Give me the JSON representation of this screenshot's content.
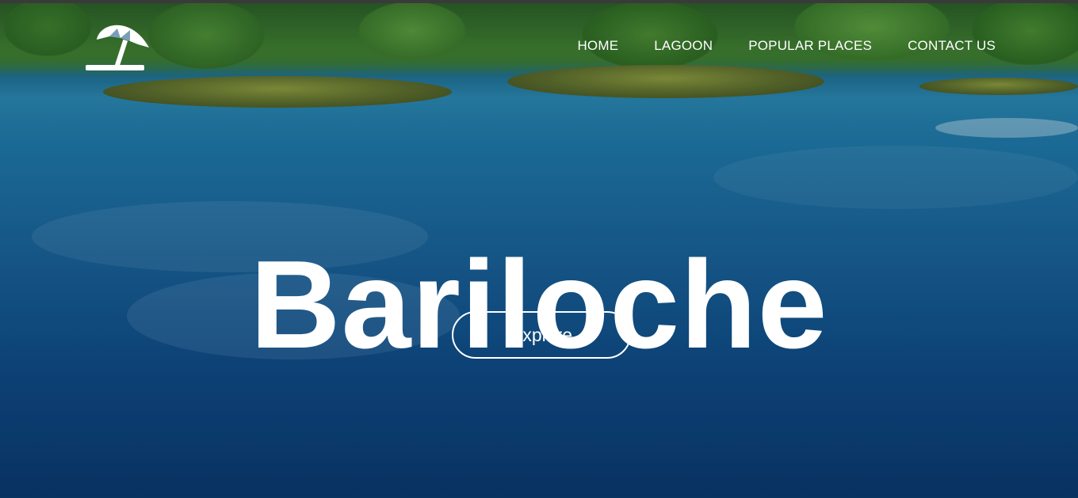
{
  "brand": {
    "logo_icon": "beach-umbrella-icon"
  },
  "nav": {
    "items": [
      {
        "label": "HOME"
      },
      {
        "label": "LAGOON"
      },
      {
        "label": "POPULAR PLACES"
      },
      {
        "label": "CONTACT US"
      }
    ]
  },
  "hero": {
    "title": "Bariloche",
    "cta_label": "Explore"
  },
  "colors": {
    "text": "#ffffff",
    "water": "#1c6a9c",
    "forest": "#3f7d2d"
  }
}
